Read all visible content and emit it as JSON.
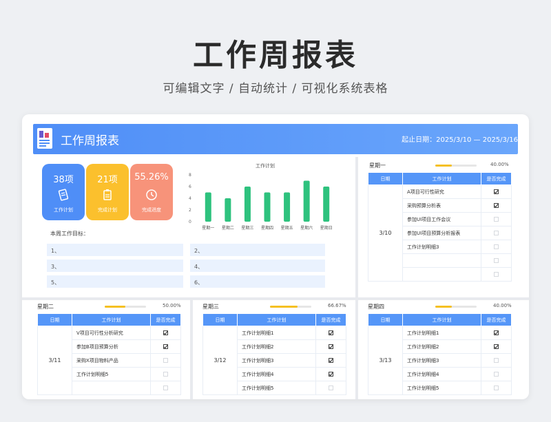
{
  "hero": {
    "title": "工作周报表",
    "subtitle": "可编辑文字 / 自动统计 / 可视化系统表格"
  },
  "header": {
    "title": "工作周报表",
    "date_range": "起止日期：2025/3/10 — 2025/3/16"
  },
  "stats": [
    {
      "value": "38项",
      "label": "工作计划",
      "icon": "document-icon",
      "color": "#4f8ef7"
    },
    {
      "value": "21项",
      "label": "完成计划",
      "icon": "clipboard-icon",
      "color": "#fbc02d"
    },
    {
      "value": "55.26%",
      "label": "完成进度",
      "icon": "clock-icon",
      "color": "#f7937a"
    }
  ],
  "chart_data": {
    "type": "bar",
    "title": "工作计划",
    "categories": [
      "星期一",
      "星期二",
      "星期三",
      "星期四",
      "星期五",
      "星期六",
      "星期日"
    ],
    "values": [
      5,
      4,
      6,
      5,
      5,
      7,
      6
    ],
    "yticks": [
      "8",
      "6",
      "4",
      "2",
      "0"
    ],
    "ylim": [
      0,
      8
    ],
    "color": "#2ec27e",
    "grid": false
  },
  "goals": {
    "label": "本周工作目标：",
    "items": [
      "1、",
      "2、",
      "3、",
      "4、",
      "5、",
      "6、"
    ]
  },
  "table_headers": {
    "date": "日期",
    "plan": "工作计划",
    "done": "是否完成"
  },
  "days": {
    "mon": {
      "name": "星期一",
      "progress": 0.4,
      "percent": "40.00%",
      "date": "3/10",
      "rows": [
        {
          "plan": "A项目可行性研究",
          "done": true
        },
        {
          "plan": "采购预算分析表",
          "done": true
        },
        {
          "plan": "参加UI项目工作会议",
          "done": false
        },
        {
          "plan": "参加UI项目预算分析报表",
          "done": false
        },
        {
          "plan": "工作计划明细3",
          "done": false
        },
        {
          "plan": "",
          "done": false
        },
        {
          "plan": "",
          "done": false
        }
      ]
    },
    "tue": {
      "name": "星期二",
      "progress": 0.5,
      "percent": "50.00%",
      "date": "3/11",
      "rows": [
        {
          "plan": "V项目可行性分析研究",
          "done": true
        },
        {
          "plan": "参加B项目预算分析",
          "done": true
        },
        {
          "plan": "采购X项目物料产品",
          "done": false
        },
        {
          "plan": "工作计划明细5",
          "done": false
        },
        {
          "plan": "",
          "done": false
        }
      ]
    },
    "wed": {
      "name": "星期三",
      "progress": 0.6667,
      "percent": "66.67%",
      "date": "3/12",
      "rows": [
        {
          "plan": "工作计划明细1",
          "done": true
        },
        {
          "plan": "工作计划明细2",
          "done": true
        },
        {
          "plan": "工作计划明细3",
          "done": true
        },
        {
          "plan": "工作计划明细4",
          "done": true
        },
        {
          "plan": "工作计划明细5",
          "done": false
        }
      ]
    },
    "thu": {
      "name": "星期四",
      "progress": 0.4,
      "percent": "40.00%",
      "date": "3/13",
      "rows": [
        {
          "plan": "工作计划明细1",
          "done": true
        },
        {
          "plan": "工作计划明细2",
          "done": true
        },
        {
          "plan": "工作计划明细3",
          "done": false
        },
        {
          "plan": "工作计划明细4",
          "done": false
        },
        {
          "plan": "工作计划明细5",
          "done": false
        }
      ]
    }
  }
}
